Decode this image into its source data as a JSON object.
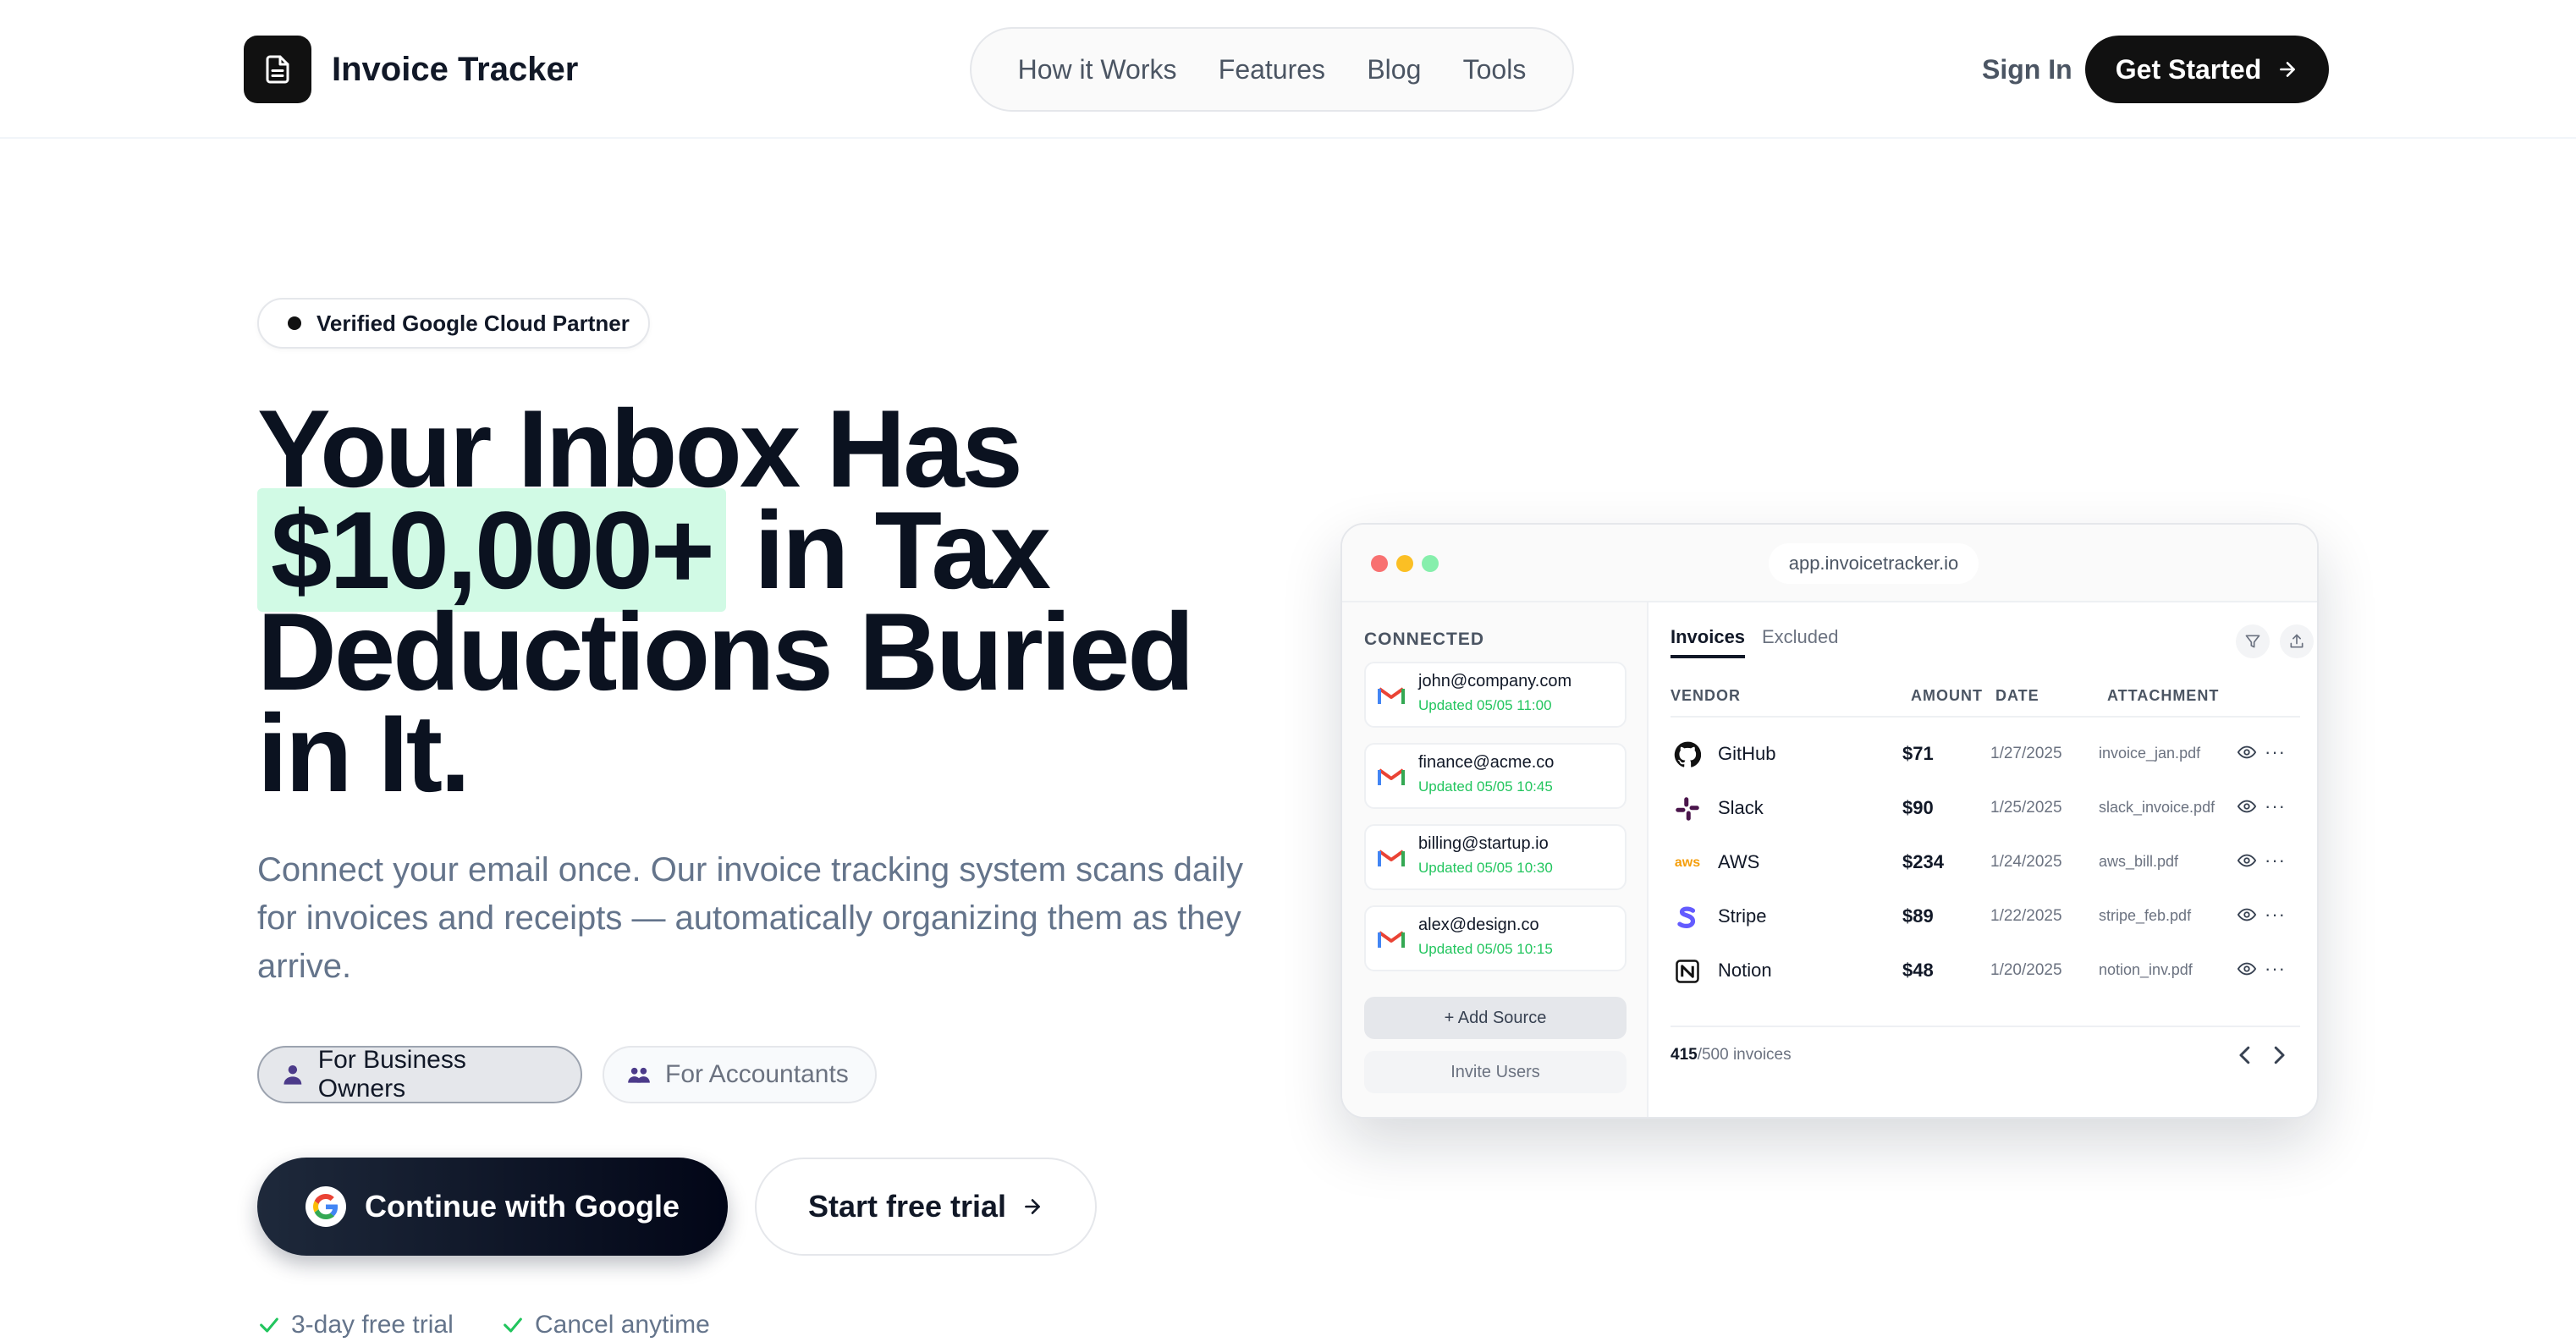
{
  "nav": {
    "brand": "Invoice Tracker",
    "links": [
      "How it Works",
      "Features",
      "Blog",
      "Tools"
    ],
    "sign_in": "Sign In",
    "get_started": "Get Started"
  },
  "hero": {
    "badge": "Verified Google Cloud Partner",
    "headline_1": "Your Inbox Has",
    "headline_highlight": "$10,000+",
    "headline_2": " in Tax",
    "headline_3": "Deductions Buried",
    "headline_4": "in It.",
    "subtext": "Connect your email once. Our invoice tracking system scans daily for invoices and receipts — automatically organizing them as they arrive.",
    "persona_business": "For Business Owners",
    "persona_accountants": "For Accountants",
    "google_button": "Continue with Google",
    "trial_button": "Start free trial",
    "perks": [
      "3-day free trial",
      "Cancel anytime"
    ]
  },
  "mock": {
    "url": "app.invoicetracker.io",
    "connected_title": "CONNECTED",
    "accounts": [
      {
        "email": "john@company.com",
        "updated": "Updated 05/05 11:00"
      },
      {
        "email": "finance@acme.co",
        "updated": "Updated 05/05 10:45"
      },
      {
        "email": "billing@startup.io",
        "updated": "Updated 05/05 10:30"
      },
      {
        "email": "alex@design.co",
        "updated": "Updated 05/05 10:15"
      }
    ],
    "add_source": "+ Add Source",
    "invite_users": "Invite Users",
    "tabs": [
      "Invoices",
      "Excluded"
    ],
    "columns": [
      "VENDOR",
      "AMOUNT",
      "DATE",
      "ATTACHMENT"
    ],
    "rows": [
      {
        "vendor": "GitHub",
        "amount": "$71",
        "date": "1/27/2025",
        "file": "invoice_jan.pdf"
      },
      {
        "vendor": "Slack",
        "amount": "$90",
        "date": "1/25/2025",
        "file": "slack_invoice.pdf"
      },
      {
        "vendor": "AWS",
        "amount": "$234",
        "date": "1/24/2025",
        "file": "aws_bill.pdf"
      },
      {
        "vendor": "Stripe",
        "amount": "$89",
        "date": "1/22/2025",
        "file": "stripe_feb.pdf"
      },
      {
        "vendor": "Notion",
        "amount": "$48",
        "date": "1/20/2025",
        "file": "notion_inv.pdf"
      }
    ],
    "count_used": "415",
    "count_total": "/500 invoices",
    "aws_mark": "aws"
  },
  "colors": {
    "accent_dark": "#111111",
    "highlight": "#d1fae5",
    "updated_green": "#22c55e"
  }
}
